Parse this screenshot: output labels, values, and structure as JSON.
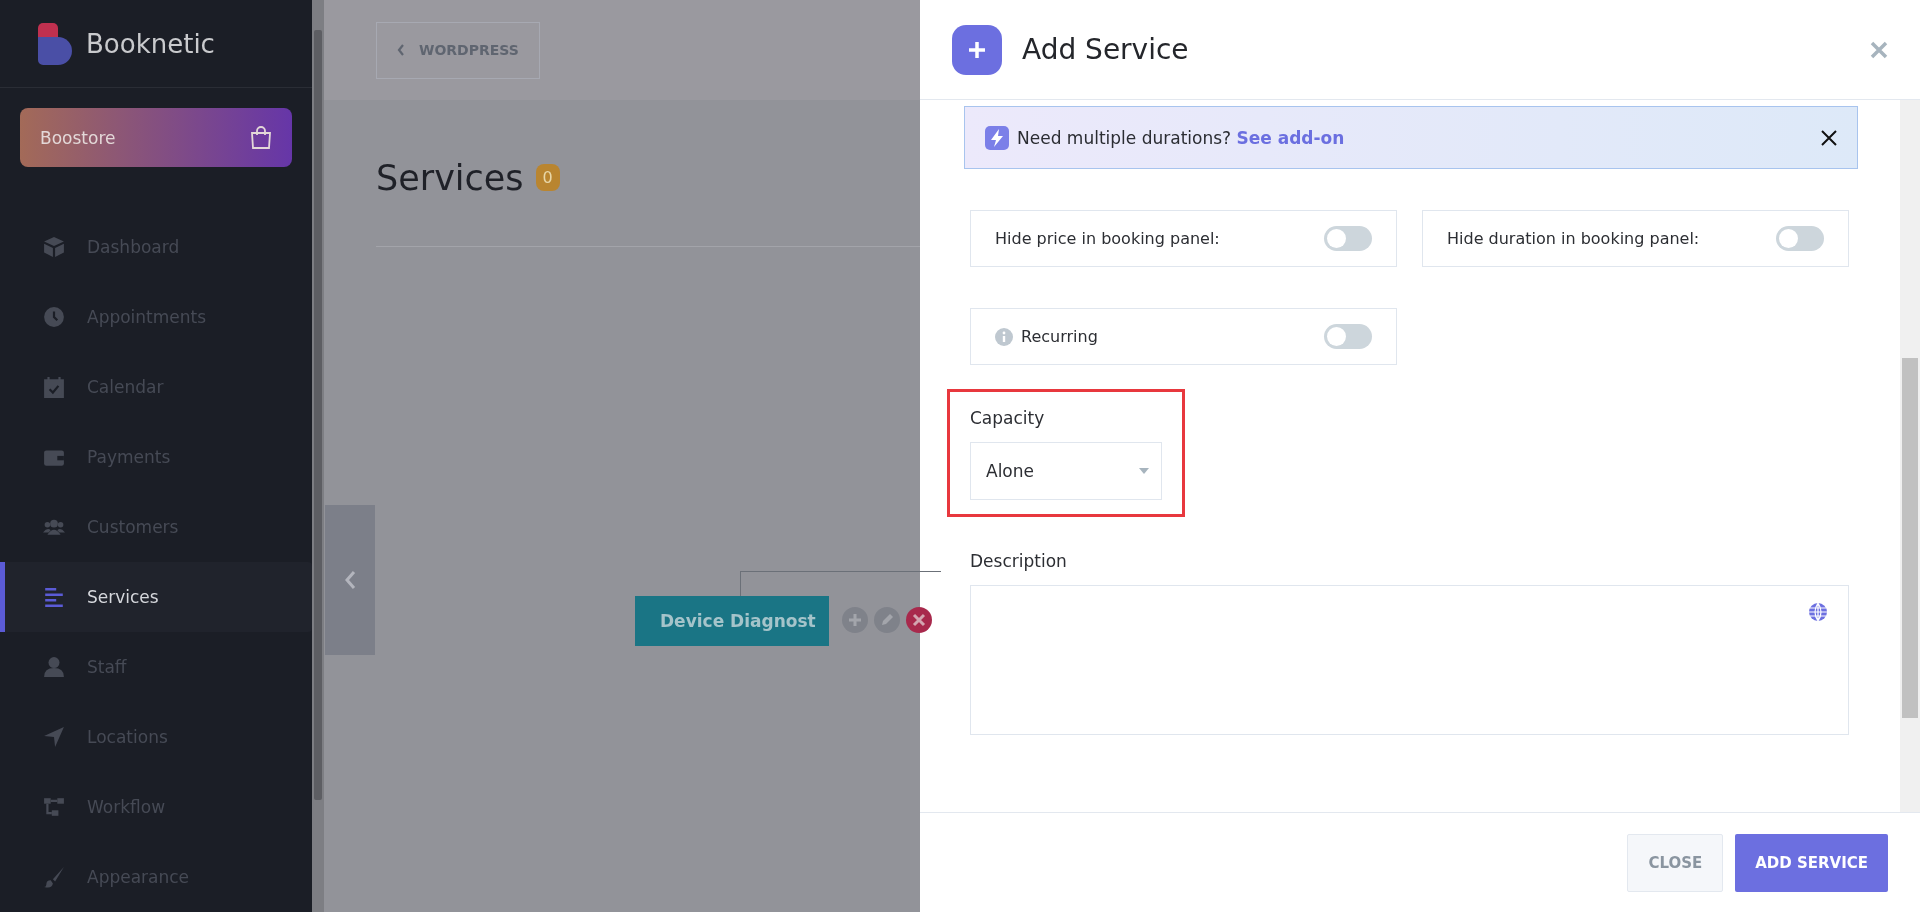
{
  "sidebar": {
    "brand": "Booknetic",
    "store_button": "Boostore",
    "items": [
      {
        "label": "Dashboard",
        "selected": false
      },
      {
        "label": "Appointments",
        "selected": false
      },
      {
        "label": "Calendar",
        "selected": false
      },
      {
        "label": "Payments",
        "selected": false
      },
      {
        "label": "Customers",
        "selected": false
      },
      {
        "label": "Services",
        "selected": true
      },
      {
        "label": "Staff",
        "selected": false
      },
      {
        "label": "Locations",
        "selected": false
      },
      {
        "label": "Workflow",
        "selected": false
      },
      {
        "label": "Appearance",
        "selected": false
      }
    ]
  },
  "main": {
    "back_button": "WORDPRESS",
    "title": "Services",
    "count": "0",
    "node_label": "Device Diagnost"
  },
  "panel": {
    "title": "Add Service",
    "banner": {
      "text": "Need multiple durations?",
      "link": "See add-on"
    },
    "toggles": [
      {
        "label": "Hide price in booking panel:",
        "kind": "plain",
        "on": false
      },
      {
        "label": "Hide duration in booking panel:",
        "kind": "plain",
        "on": false
      },
      {
        "label": "Recurring",
        "kind": "info",
        "on": false
      }
    ],
    "capacity": {
      "label": "Capacity",
      "value": "Alone"
    },
    "description": {
      "label": "Description"
    },
    "buttons": [
      {
        "label": "CLOSE",
        "kind": "secondary"
      },
      {
        "label": "ADD SERVICE",
        "kind": "primary"
      }
    ]
  }
}
